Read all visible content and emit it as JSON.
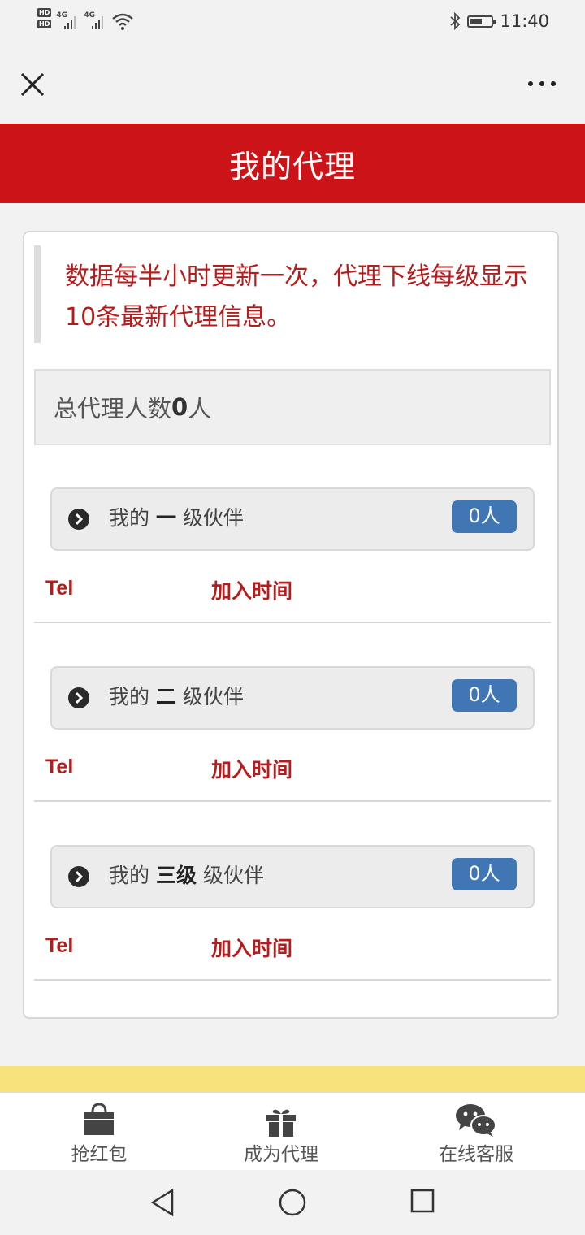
{
  "status_bar": {
    "network_1": "4G",
    "network_2": "4G",
    "hd_1": "HD",
    "hd_2": "HD",
    "time": "11:40",
    "icons": [
      "bluetooth-icon",
      "battery-icon",
      "wifi-icon",
      "signal-icon"
    ]
  },
  "nav": {
    "close_icon": "close-icon",
    "more_icon": "more-icon"
  },
  "header": {
    "title": "我的代理"
  },
  "notice": {
    "text": "数据每半小时更新一次，代理下线每级显示10条最新代理信息。"
  },
  "summary": {
    "prefix": "总代理人数",
    "count": "0",
    "suffix": "人"
  },
  "levels": [
    {
      "prefix": "我的 ",
      "level": "一",
      "suffix": " 级伙伴",
      "badge": "0人",
      "col_tel": "Tel",
      "col_join": "加入时间"
    },
    {
      "prefix": "我的 ",
      "level": "二",
      "suffix": " 级伙伴",
      "badge": "0人",
      "col_tel": "Tel",
      "col_join": "加入时间"
    },
    {
      "prefix": "我的 ",
      "level": "三级",
      "suffix": " 级伙伴",
      "badge": "0人",
      "col_tel": "Tel",
      "col_join": "加入时间"
    }
  ],
  "tabbar": {
    "tabs": [
      {
        "label": "抢红包",
        "icon": "shopping-bag-icon"
      },
      {
        "label": "成为代理",
        "icon": "gift-icon"
      },
      {
        "label": "在线客服",
        "icon": "wechat-icon"
      }
    ]
  },
  "colors": {
    "primary_red": "#cc1418",
    "text_red": "#b81b1b",
    "badge_blue": "#3f76b3",
    "strip_yellow": "#f7e27c"
  }
}
